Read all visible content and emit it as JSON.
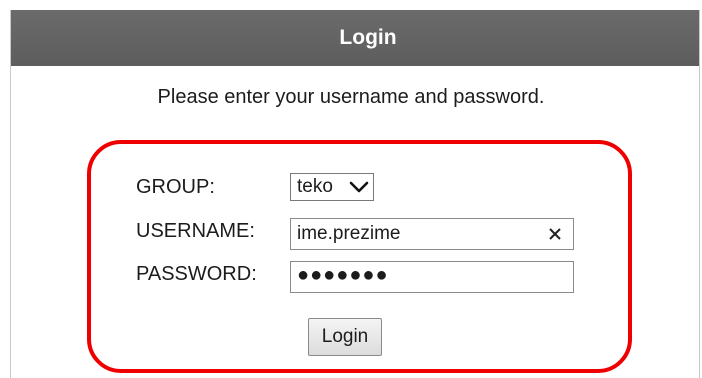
{
  "header": {
    "title": "Login"
  },
  "prompt": "Please enter your username and password.",
  "form": {
    "group_label": "GROUP:",
    "group_value": "teko",
    "username_label": "USERNAME:",
    "username_value": "ime.prezime",
    "password_label": "PASSWORD:",
    "password_value": "●●●●●●●"
  },
  "button": {
    "label": "Login"
  },
  "icons": {
    "select_chevron": "chevron-down-icon",
    "clear": "close-icon"
  },
  "colors": {
    "header_bg": "#626262",
    "highlight": "#ef0000"
  }
}
